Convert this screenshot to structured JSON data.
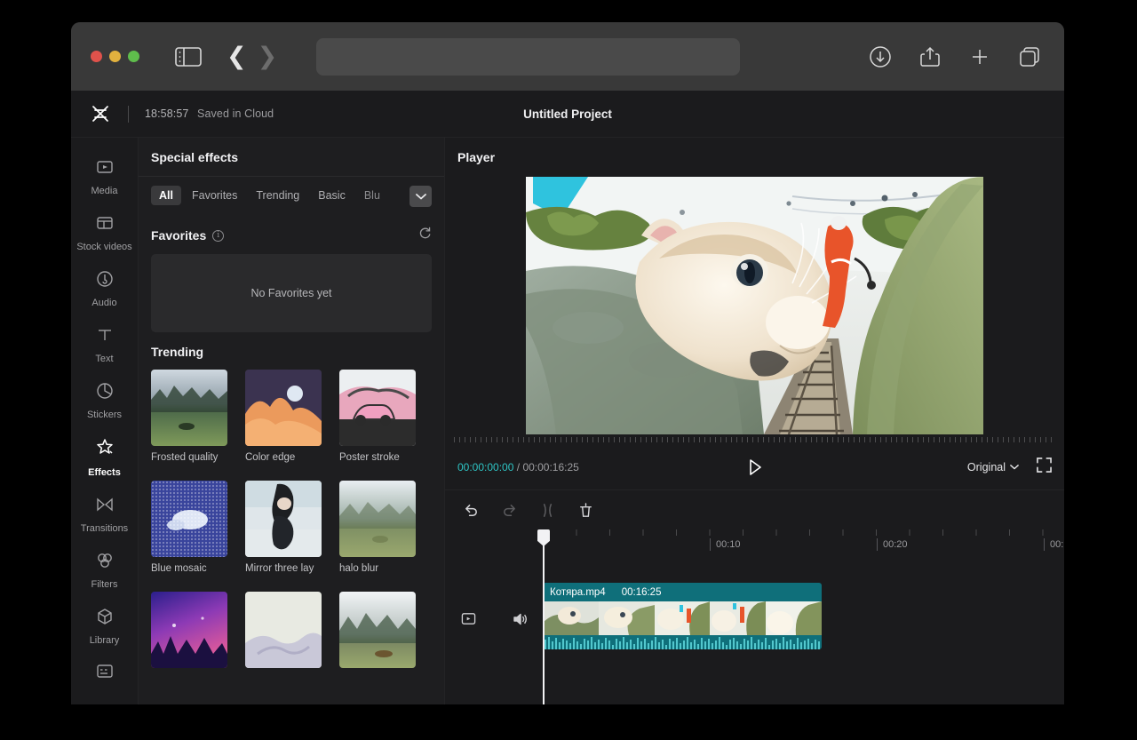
{
  "browser": {
    "address_value": "",
    "address_placeholder": "",
    "icons": {
      "sidebar": "sidebar-toggle-icon",
      "back": "back-arrow-icon",
      "forward": "forward-arrow-icon",
      "download": "download-icon",
      "share": "share-icon",
      "new_tab": "plus-icon",
      "tabs": "tab-overview-icon"
    },
    "traffic_lights": [
      "close",
      "minimize",
      "zoom"
    ]
  },
  "topbar": {
    "logo": "capcut-logo-icon",
    "time": "18:58:57",
    "save_status": "Saved in Cloud",
    "project_title": "Untitled Project"
  },
  "sidebar": {
    "items": [
      {
        "label": "Media",
        "icon": "media-icon",
        "active": false
      },
      {
        "label": "Stock videos",
        "icon": "stock-videos-icon",
        "active": false
      },
      {
        "label": "Audio",
        "icon": "audio-icon",
        "active": false
      },
      {
        "label": "Text",
        "icon": "text-icon",
        "active": false
      },
      {
        "label": "Stickers",
        "icon": "stickers-icon",
        "active": false
      },
      {
        "label": "Effects",
        "icon": "effects-icon",
        "active": true
      },
      {
        "label": "Transitions",
        "icon": "transitions-icon",
        "active": false
      },
      {
        "label": "Filters",
        "icon": "filters-icon",
        "active": false
      },
      {
        "label": "Library",
        "icon": "library-icon",
        "active": false
      },
      {
        "label": "",
        "icon": "captions-icon",
        "active": false
      }
    ]
  },
  "panel": {
    "title": "Special effects",
    "tabs": [
      {
        "label": "All",
        "active": true
      },
      {
        "label": "Favorites",
        "active": false
      },
      {
        "label": "Trending",
        "active": false
      },
      {
        "label": "Basic",
        "active": false
      },
      {
        "label": "Blu",
        "active": false,
        "clipped": true
      }
    ],
    "more_icon": "chevron-down-icon",
    "favorites": {
      "title": "Favorites",
      "info_icon": "info-icon",
      "refresh_icon": "refresh-icon",
      "empty_text": "No Favorites yet"
    },
    "trending": {
      "title": "Trending",
      "items": [
        {
          "label": "Frosted quality",
          "thumb": "forest-meadow"
        },
        {
          "label": "Color edge",
          "thumb": "orange-cloud-moon"
        },
        {
          "label": "Poster stroke",
          "thumb": "pink-car"
        },
        {
          "label": "Blue mosaic",
          "thumb": "blue-dots"
        },
        {
          "label": "Mirror three lay",
          "thumb": "mirror-girl"
        },
        {
          "label": "halo blur",
          "thumb": "blurred-field"
        },
        {
          "label": "",
          "thumb": "purple-concert"
        },
        {
          "label": "",
          "thumb": "white-marble"
        },
        {
          "label": "",
          "thumb": "foggy-deer"
        }
      ]
    }
  },
  "player": {
    "title": "Player",
    "current_time": "00:00:00:00",
    "separator": "/",
    "total_time": "00:00:16:25",
    "play_icon": "play-icon",
    "quality_label": "Original",
    "quality_chevron": "chevron-down-icon",
    "fullscreen_icon": "fullscreen-icon"
  },
  "timeline": {
    "toolbar": [
      {
        "name": "undo-button",
        "icon": "undo-icon",
        "enabled": true
      },
      {
        "name": "redo-button",
        "icon": "redo-icon",
        "enabled": false
      },
      {
        "name": "split-button",
        "icon": "split-icon",
        "enabled": false
      },
      {
        "name": "delete-button",
        "icon": "trash-icon",
        "enabled": true
      }
    ],
    "ruler_labels": [
      "00:10",
      "00:20",
      "00:"
    ],
    "track": {
      "video_icon": "video-track-icon",
      "audio_icon": "speaker-icon"
    },
    "clip": {
      "name": "Котяра.mp4",
      "duration": "00:16:25"
    },
    "playhead_position": "00:00:00:00"
  },
  "colors": {
    "accent_teal": "#2ec4c4",
    "clip_teal": "#0f6f7a",
    "panel_bg": "#1e1e20",
    "chrome_bg": "#393939",
    "app_bg": "#1b1b1d"
  }
}
